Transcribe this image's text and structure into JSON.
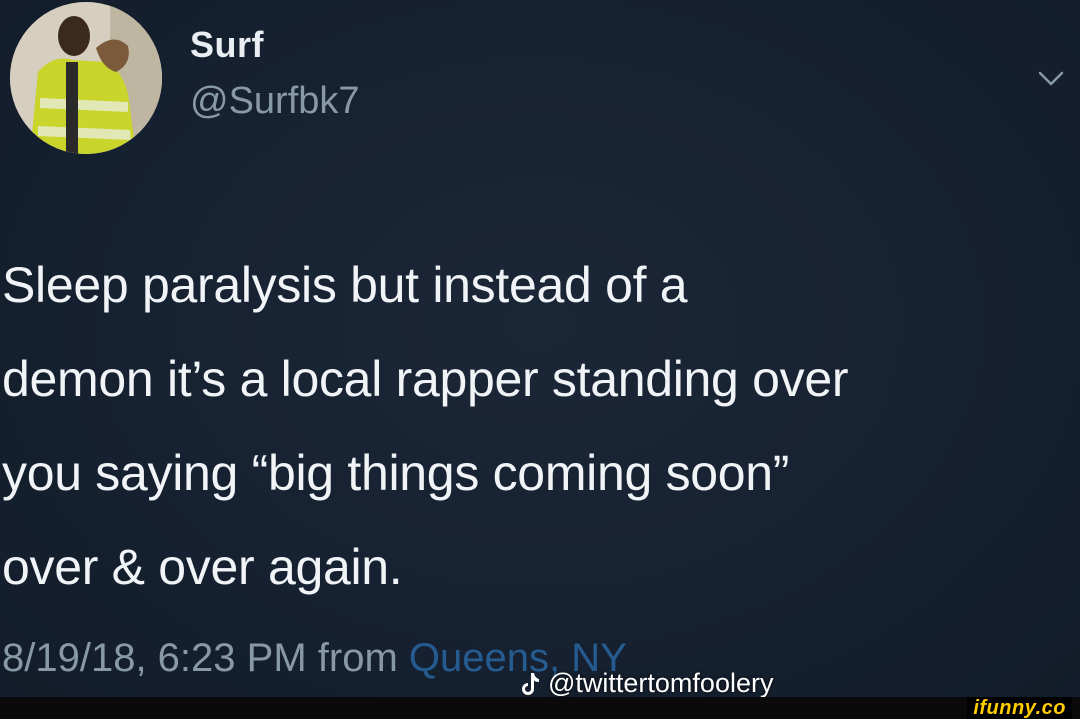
{
  "tweet": {
    "display_name": "Surf",
    "handle": "@Surfbk7",
    "text": "Sleep paralysis but instead of a\ndemon it’s a local rapper standing over\nyou saying “big things coming soon”\nover & over again.",
    "timestamp_prefix": "8/19/18, 6:23 PM from ",
    "location": "Queens, NY"
  },
  "watermarks": {
    "tiktok_handle": "@twittertomfoolery",
    "ifunny": "ifunny.co"
  },
  "icons": {
    "menu": "chevron-down-icon",
    "tiktok": "tiktok-note-icon"
  },
  "colors": {
    "background": "#15202b",
    "text": "#f1f4f7",
    "secondary": "#8899a6",
    "link": "#2c6fb1",
    "ifunny": "#ffcc00"
  }
}
